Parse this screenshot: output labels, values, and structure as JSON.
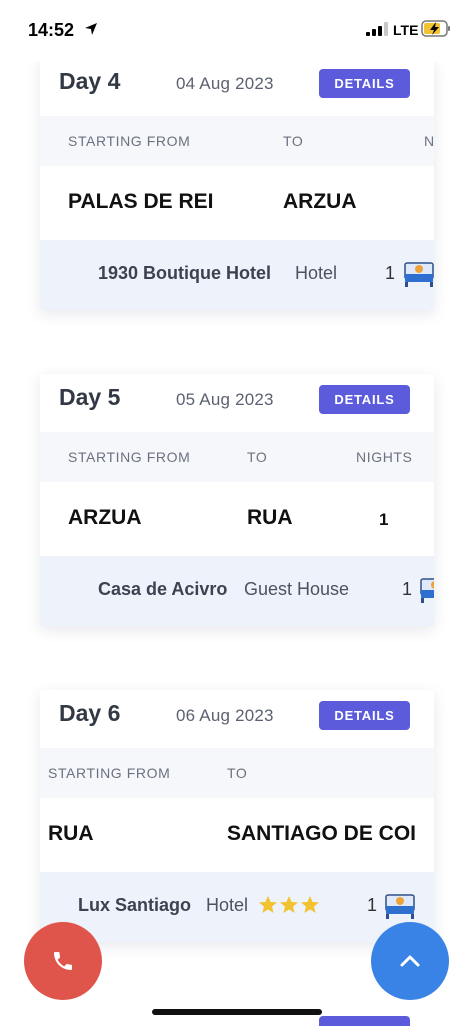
{
  "status_bar": {
    "time": "14:52",
    "network": "LTE",
    "location_icon": "location-arrow-icon",
    "battery_icon": "battery-charging-icon"
  },
  "colors": {
    "accent": "#5b5bdc",
    "call": "#e0554b",
    "scroll_top": "#3a83e6",
    "stay_bg": "#eef2fb",
    "star": "#f2c230"
  },
  "days": [
    {
      "day_label": "Day 4",
      "date": "04 Aug 2023",
      "details_label": "DETAILS",
      "headers": {
        "from": "STARTING FROM",
        "to": "TO",
        "nights": "N"
      },
      "route": {
        "from": "PALAS DE REI",
        "to": "ARZUA",
        "nights": ""
      },
      "stay": {
        "name": "1930 Boutique Hotel",
        "type": "Hotel",
        "nights": "1",
        "stars": 0
      }
    },
    {
      "day_label": "Day 5",
      "date": "05 Aug 2023",
      "details_label": "DETAILS",
      "headers": {
        "from": "STARTING FROM",
        "to": "TO",
        "nights": "NIGHTS"
      },
      "route": {
        "from": "ARZUA",
        "to": "RUA",
        "nights": "1"
      },
      "stay": {
        "name": "Casa de Acivro",
        "type": "Guest House",
        "nights": "1",
        "stars": 0
      }
    },
    {
      "day_label": "Day 6",
      "date": "06 Aug 2023",
      "details_label": "DETAILS",
      "headers": {
        "from": "STARTING FROM",
        "to": "TO",
        "nights": ""
      },
      "route": {
        "from": "RUA",
        "to": "SANTIAGO DE COI",
        "nights": ""
      },
      "stay": {
        "name": "Lux Santiago",
        "type": "Hotel",
        "nights": "1",
        "stars": 3
      }
    }
  ],
  "fab": {
    "call_icon": "phone-icon",
    "scroll_up_icon": "chevron-up-icon"
  }
}
